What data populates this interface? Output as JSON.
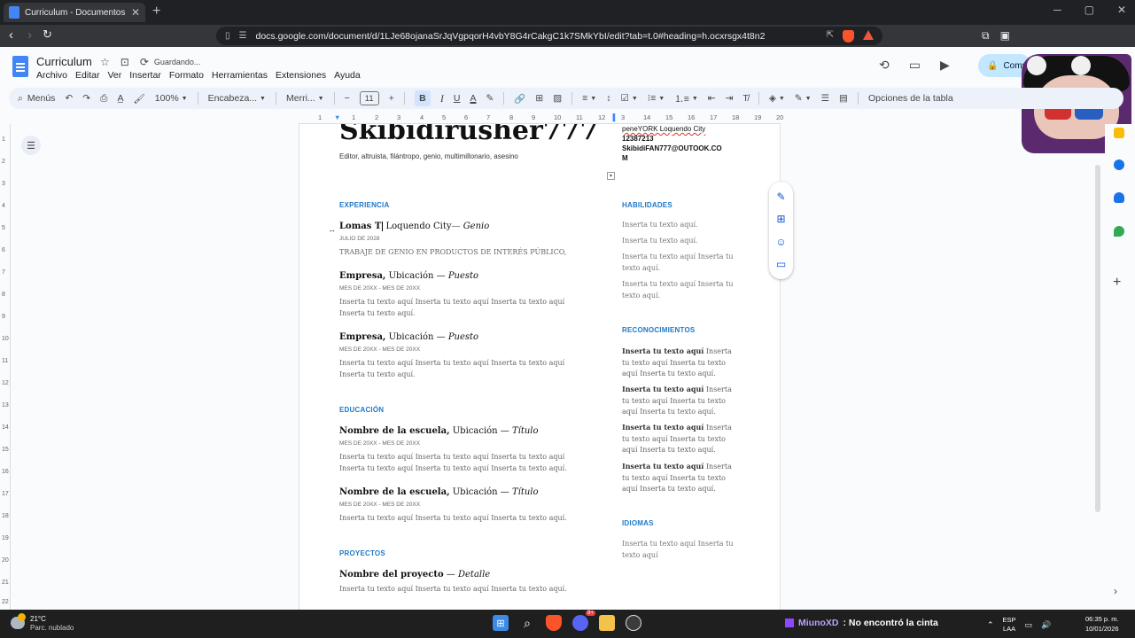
{
  "browser": {
    "tab_title": "Curriculum - Documentos de Go...",
    "url": "docs.google.com/document/d/1LJe68ojanaSrJqVgpqorH4vbY8G4rCakgC1k7SMkYbI/edit?tab=t.0#heading=h.ocxrsgx4t8n2",
    "brave_badge": "4"
  },
  "docs": {
    "title": "Curriculum",
    "status": "Guardando...",
    "menu": [
      "Archivo",
      "Editar",
      "Ver",
      "Insertar",
      "Formato",
      "Herramientas",
      "Extensiones",
      "Ayuda"
    ],
    "share_label": "Comp"
  },
  "toolbar": {
    "search": "Menús",
    "zoom": "100%",
    "style": "Encabeza...",
    "font": "Merri...",
    "font_size": "11",
    "table_options": "Opciones de la tabla"
  },
  "ruler": {
    "h": [
      "1",
      "1",
      "2",
      "3",
      "4",
      "5",
      "6",
      "7",
      "8",
      "9",
      "10",
      "11",
      "12",
      "13",
      "3",
      "14",
      "15",
      "16",
      "17",
      "18",
      "19",
      "20"
    ],
    "v": [
      "1",
      "2",
      "3",
      "4",
      "5",
      "6",
      "7",
      "8",
      "9",
      "10",
      "11",
      "12",
      "13",
      "14",
      "15",
      "16",
      "17",
      "18",
      "19",
      "20",
      "21",
      "22"
    ]
  },
  "resume": {
    "name": "Skibidirusher777",
    "subtitle": "Editor, altruista, filántropo, genio, multimillonario, asesino",
    "contact": [
      "peneYORK Loquendo City",
      "12387213",
      "SkibidiFAN777@OUTOOK.CO",
      "M"
    ],
    "experience_heading": "EXPERIENCIA",
    "jobs": [
      {
        "company": "Lomas T",
        "location": " Loquendo City",
        "role": "Genio",
        "date": "JULIO DE 2028",
        "desc": "TRABAJE DE GENIO EN PRODUCTOS DE INTERÉS PÚBLICO,"
      },
      {
        "company": "Empresa,",
        "location": " Ubicación — ",
        "role": "Puesto",
        "date": "MES DE 20XX - MES DE 20XX",
        "desc": "Inserta tu texto aquí Inserta tu texto aquí Inserta tu texto aquí Inserta tu texto aquí."
      },
      {
        "company": "Empresa,",
        "location": " Ubicación — ",
        "role": "Puesto",
        "date": "MES DE 20XX - MES DE 20XX",
        "desc": "Inserta tu texto aquí Inserta tu texto aquí Inserta tu texto aquí Inserta tu texto aquí."
      }
    ],
    "education_heading": "EDUCACIÓN",
    "schools": [
      {
        "school": "Nombre de la escuela,",
        "location": " Ubicación — ",
        "degree": "Título",
        "date": "MES DE 20XX - MES DE 20XX",
        "desc": "Inserta tu texto aquí Inserta tu texto aquí Inserta tu texto aquí Inserta tu texto aquí Inserta tu texto aquí Inserta tu texto aquí."
      },
      {
        "school": "Nombre de la escuela,",
        "location": " Ubicación — ",
        "degree": "Título",
        "date": "MES DE 20XX - MES DE 20XX",
        "desc": "Inserta tu texto aquí Inserta tu texto aquí Inserta tu texto aquí."
      }
    ],
    "projects_heading": "PROYECTOS",
    "project": {
      "name": "Nombre del proyecto",
      "sep": " — ",
      "detail": "Detalle",
      "desc": "Inserta tu texto aquí Inserta tu texto aquí Inserta tu texto aquí."
    },
    "skills_heading": "HABILIDADES",
    "skills": [
      "Inserta tu texto aquí.",
      "Inserta tu texto aquí.",
      "Inserta tu texto aquí Inserta tu texto aquí.",
      "Inserta tu texto aquí Inserta tu texto aquí."
    ],
    "awards_heading": "RECONOCIMIENTOS",
    "awards": [
      {
        "bold": "Inserta tu texto aquí",
        "rest": " Inserta tu texto aquí Inserta tu texto aquí Inserta tu texto aquí."
      },
      {
        "bold": "Inserta tu texto aquí",
        "rest": " Inserta tu texto aquí Inserta tu texto aquí Inserta tu texto aquí."
      },
      {
        "bold": "Inserta tu texto aquí",
        "rest": " Inserta tu texto aquí Inserta tu texto aquí Inserta tu texto aquí."
      },
      {
        "bold": "Inserta tu texto aquí",
        "rest": " Inserta tu texto aquí Inserta tu texto aquí Inserta tu texto aquí."
      }
    ],
    "languages_heading": "IDIOMAS",
    "languages": "Inserta tu texto aquí Inserta tu texto aquí"
  },
  "taskbar": {
    "temp": "21°C",
    "condition": "Parc. nublado",
    "discord_badge": "9+",
    "now_playing_user": "MiunoXD",
    "now_playing_text": " : No encontró la cinta",
    "lang_top": "ESP",
    "lang_bottom": "LAA",
    "time": "06:35 p. m.",
    "date": "10/01/2026"
  },
  "colors": {
    "accent_blue": "#2079c7",
    "share_bg": "#c2e7ff",
    "toolbar_bg": "#edf2fa"
  }
}
